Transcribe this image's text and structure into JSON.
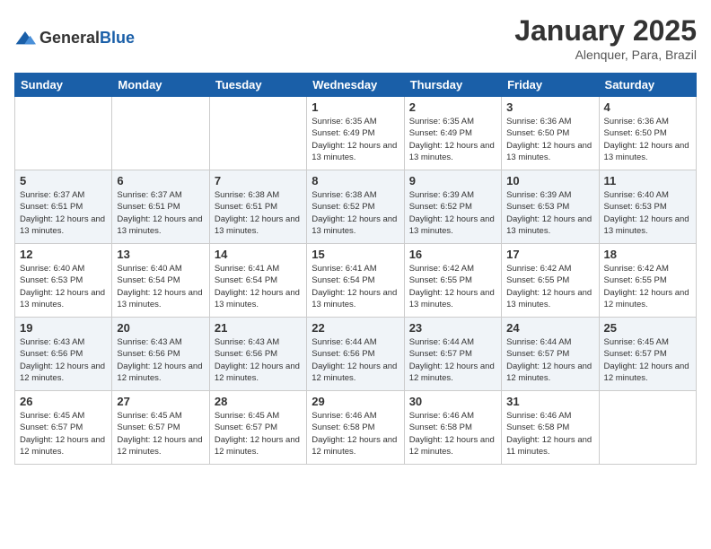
{
  "logo": {
    "general": "General",
    "blue": "Blue"
  },
  "header": {
    "month": "January 2025",
    "location": "Alenquer, Para, Brazil"
  },
  "weekdays": [
    "Sunday",
    "Monday",
    "Tuesday",
    "Wednesday",
    "Thursday",
    "Friday",
    "Saturday"
  ],
  "weeks": [
    [
      {
        "day": "",
        "info": ""
      },
      {
        "day": "",
        "info": ""
      },
      {
        "day": "",
        "info": ""
      },
      {
        "day": "1",
        "info": "Sunrise: 6:35 AM\nSunset: 6:49 PM\nDaylight: 12 hours\nand 13 minutes."
      },
      {
        "day": "2",
        "info": "Sunrise: 6:35 AM\nSunset: 6:49 PM\nDaylight: 12 hours\nand 13 minutes."
      },
      {
        "day": "3",
        "info": "Sunrise: 6:36 AM\nSunset: 6:50 PM\nDaylight: 12 hours\nand 13 minutes."
      },
      {
        "day": "4",
        "info": "Sunrise: 6:36 AM\nSunset: 6:50 PM\nDaylight: 12 hours\nand 13 minutes."
      }
    ],
    [
      {
        "day": "5",
        "info": "Sunrise: 6:37 AM\nSunset: 6:51 PM\nDaylight: 12 hours\nand 13 minutes."
      },
      {
        "day": "6",
        "info": "Sunrise: 6:37 AM\nSunset: 6:51 PM\nDaylight: 12 hours\nand 13 minutes."
      },
      {
        "day": "7",
        "info": "Sunrise: 6:38 AM\nSunset: 6:51 PM\nDaylight: 12 hours\nand 13 minutes."
      },
      {
        "day": "8",
        "info": "Sunrise: 6:38 AM\nSunset: 6:52 PM\nDaylight: 12 hours\nand 13 minutes."
      },
      {
        "day": "9",
        "info": "Sunrise: 6:39 AM\nSunset: 6:52 PM\nDaylight: 12 hours\nand 13 minutes."
      },
      {
        "day": "10",
        "info": "Sunrise: 6:39 AM\nSunset: 6:53 PM\nDaylight: 12 hours\nand 13 minutes."
      },
      {
        "day": "11",
        "info": "Sunrise: 6:40 AM\nSunset: 6:53 PM\nDaylight: 12 hours\nand 13 minutes."
      }
    ],
    [
      {
        "day": "12",
        "info": "Sunrise: 6:40 AM\nSunset: 6:53 PM\nDaylight: 12 hours\nand 13 minutes."
      },
      {
        "day": "13",
        "info": "Sunrise: 6:40 AM\nSunset: 6:54 PM\nDaylight: 12 hours\nand 13 minutes."
      },
      {
        "day": "14",
        "info": "Sunrise: 6:41 AM\nSunset: 6:54 PM\nDaylight: 12 hours\nand 13 minutes."
      },
      {
        "day": "15",
        "info": "Sunrise: 6:41 AM\nSunset: 6:54 PM\nDaylight: 12 hours\nand 13 minutes."
      },
      {
        "day": "16",
        "info": "Sunrise: 6:42 AM\nSunset: 6:55 PM\nDaylight: 12 hours\nand 13 minutes."
      },
      {
        "day": "17",
        "info": "Sunrise: 6:42 AM\nSunset: 6:55 PM\nDaylight: 12 hours\nand 13 minutes."
      },
      {
        "day": "18",
        "info": "Sunrise: 6:42 AM\nSunset: 6:55 PM\nDaylight: 12 hours\nand 12 minutes."
      }
    ],
    [
      {
        "day": "19",
        "info": "Sunrise: 6:43 AM\nSunset: 6:56 PM\nDaylight: 12 hours\nand 12 minutes."
      },
      {
        "day": "20",
        "info": "Sunrise: 6:43 AM\nSunset: 6:56 PM\nDaylight: 12 hours\nand 12 minutes."
      },
      {
        "day": "21",
        "info": "Sunrise: 6:43 AM\nSunset: 6:56 PM\nDaylight: 12 hours\nand 12 minutes."
      },
      {
        "day": "22",
        "info": "Sunrise: 6:44 AM\nSunset: 6:56 PM\nDaylight: 12 hours\nand 12 minutes."
      },
      {
        "day": "23",
        "info": "Sunrise: 6:44 AM\nSunset: 6:57 PM\nDaylight: 12 hours\nand 12 minutes."
      },
      {
        "day": "24",
        "info": "Sunrise: 6:44 AM\nSunset: 6:57 PM\nDaylight: 12 hours\nand 12 minutes."
      },
      {
        "day": "25",
        "info": "Sunrise: 6:45 AM\nSunset: 6:57 PM\nDaylight: 12 hours\nand 12 minutes."
      }
    ],
    [
      {
        "day": "26",
        "info": "Sunrise: 6:45 AM\nSunset: 6:57 PM\nDaylight: 12 hours\nand 12 minutes."
      },
      {
        "day": "27",
        "info": "Sunrise: 6:45 AM\nSunset: 6:57 PM\nDaylight: 12 hours\nand 12 minutes."
      },
      {
        "day": "28",
        "info": "Sunrise: 6:45 AM\nSunset: 6:57 PM\nDaylight: 12 hours\nand 12 minutes."
      },
      {
        "day": "29",
        "info": "Sunrise: 6:46 AM\nSunset: 6:58 PM\nDaylight: 12 hours\nand 12 minutes."
      },
      {
        "day": "30",
        "info": "Sunrise: 6:46 AM\nSunset: 6:58 PM\nDaylight: 12 hours\nand 12 minutes."
      },
      {
        "day": "31",
        "info": "Sunrise: 6:46 AM\nSunset: 6:58 PM\nDaylight: 12 hours\nand 11 minutes."
      },
      {
        "day": "",
        "info": ""
      }
    ]
  ]
}
